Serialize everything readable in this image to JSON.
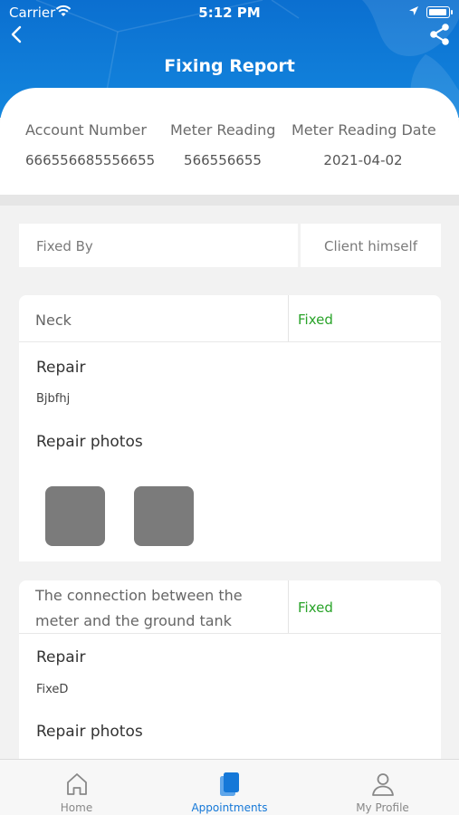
{
  "status_bar": {
    "carrier": "Carrier",
    "time": "5:12 PM"
  },
  "header": {
    "title": "Fixing Report"
  },
  "account": {
    "account_number_label": "Account Number",
    "account_number": "666556685556655",
    "meter_reading_label": "Meter Reading",
    "meter_reading": "566556655",
    "meter_reading_date_label": "Meter Reading Date",
    "meter_reading_date": "2021-04-02"
  },
  "fixed_by": {
    "label": "Fixed By",
    "value": "Client himself"
  },
  "items": [
    {
      "name": "Neck",
      "status": "Fixed",
      "repair_label": "Repair",
      "repair_text": "Bjbfhj",
      "photos_label": "Repair photos"
    },
    {
      "name_line1": "The connection between the",
      "name_line2": "meter and the ground tank",
      "status": "Fixed",
      "repair_label": "Repair",
      "repair_text": "FixeD",
      "photos_label": "Repair photos"
    }
  ],
  "tabbar": {
    "tabs": [
      {
        "label": "Home",
        "icon": "home-icon"
      },
      {
        "label": "Appointments",
        "icon": "appointments-icon"
      },
      {
        "label": "My Profile",
        "icon": "profile-icon"
      }
    ],
    "active": "Appointments"
  },
  "colors": {
    "header": "#0b6fd0",
    "status_fixed": "#29a329",
    "active_tab": "#1578d8",
    "photo_placeholder": "#7b7b7b"
  }
}
